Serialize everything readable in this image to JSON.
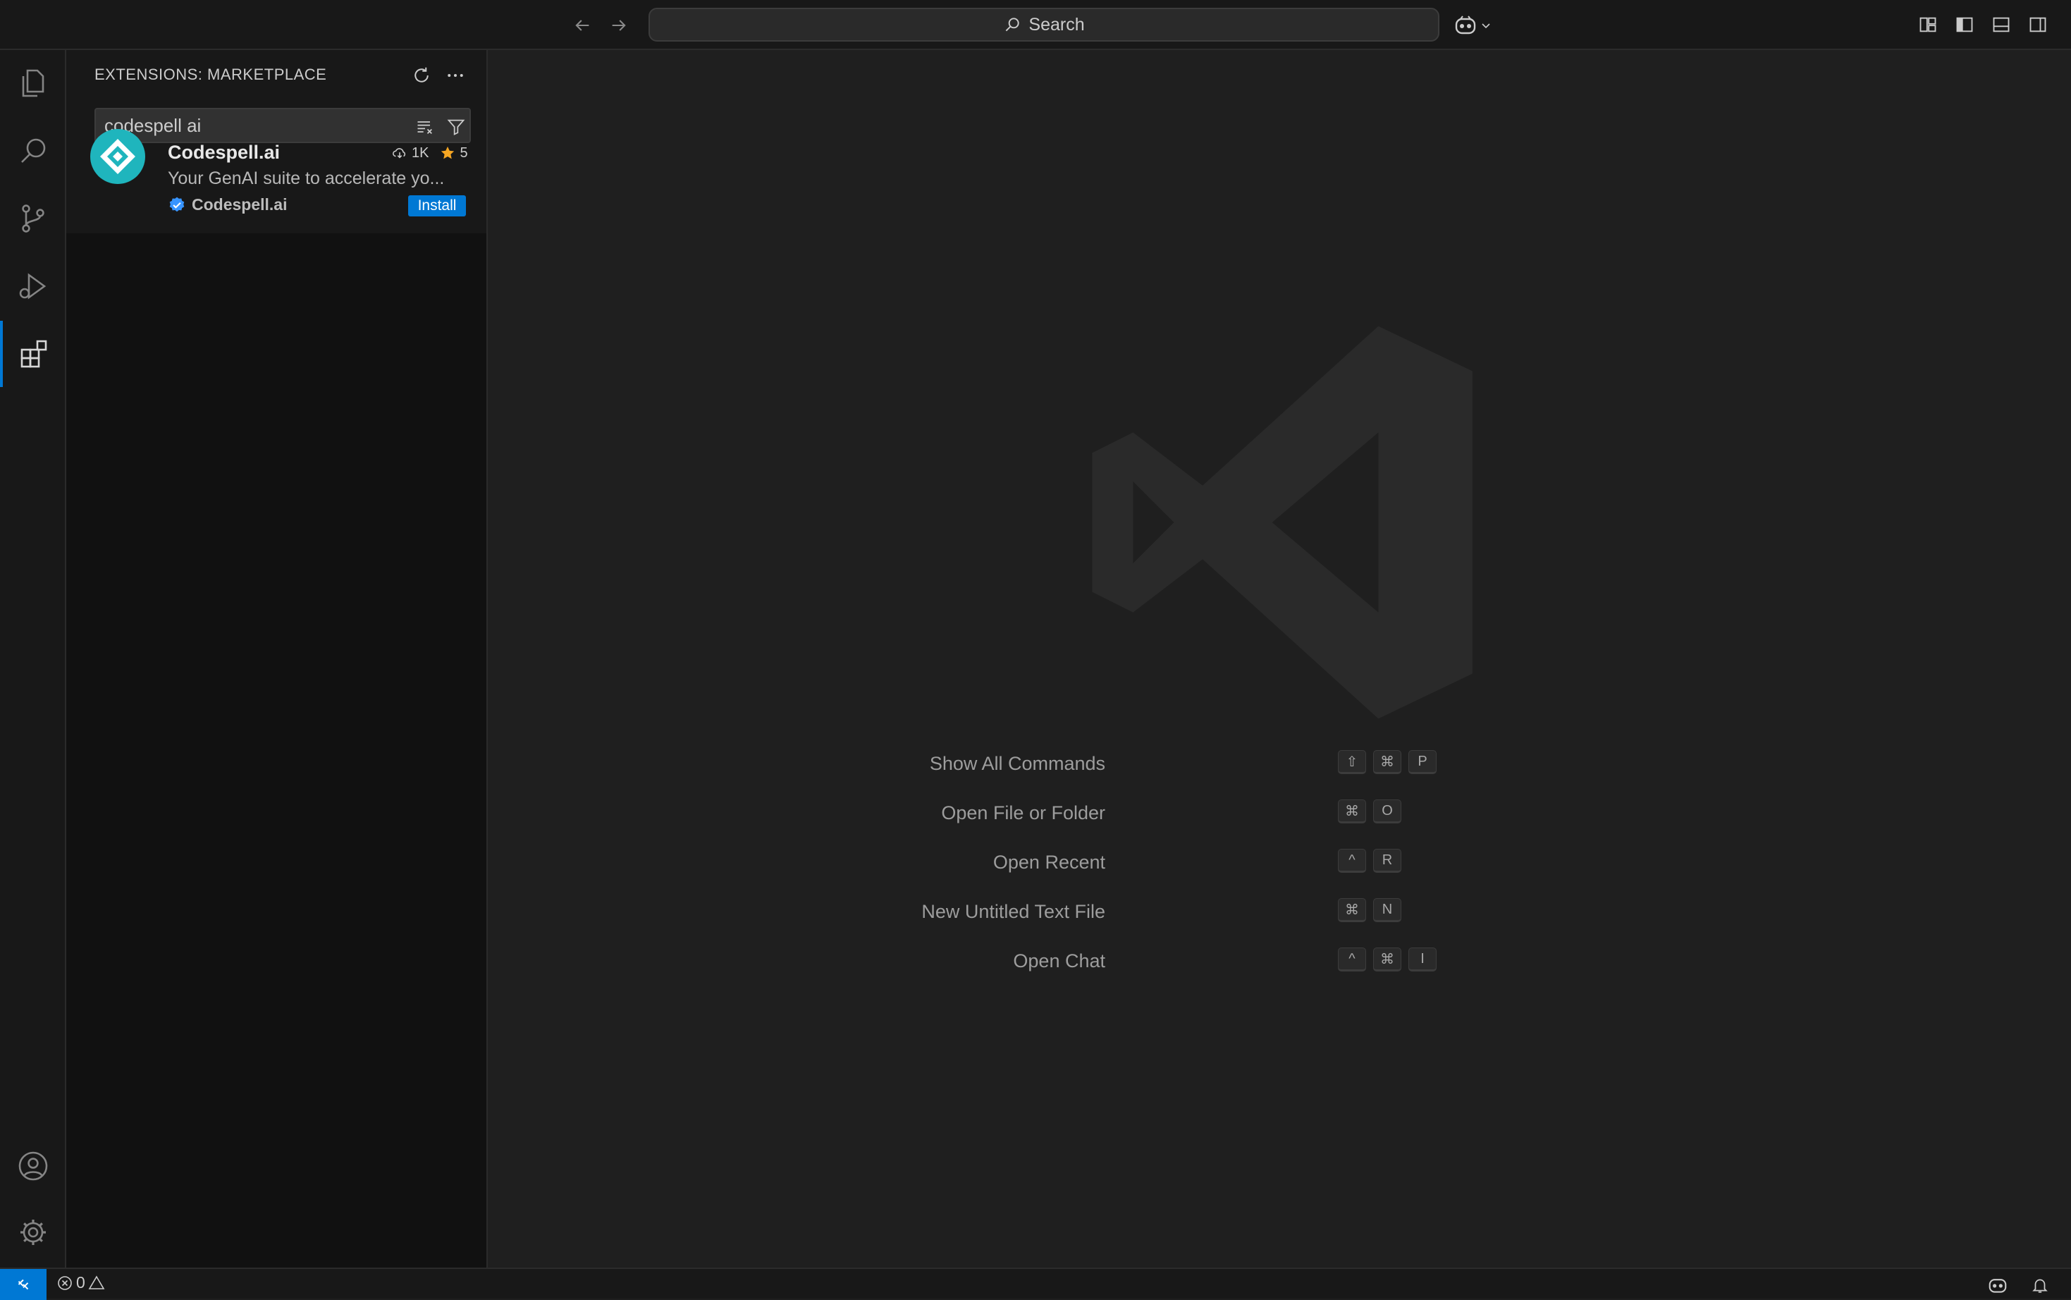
{
  "titlebar": {
    "search_label": "Search"
  },
  "sidebar": {
    "title": "EXTENSIONS: MARKETPLACE",
    "search_value": "codespell ai"
  },
  "extension": {
    "name": "Codespell.ai",
    "installs": "1K",
    "rating": "5",
    "description": "Your GenAI suite to accelerate yo...",
    "publisher": "Codespell.ai",
    "install_label": "Install"
  },
  "welcome": {
    "commands": [
      {
        "label": "Show All Commands",
        "keys": [
          "⇧",
          "⌘",
          "P"
        ]
      },
      {
        "label": "Open File or Folder",
        "keys": [
          "⌘",
          "O"
        ]
      },
      {
        "label": "Open Recent",
        "keys": [
          "^",
          "R"
        ]
      },
      {
        "label": "New Untitled Text File",
        "keys": [
          "⌘",
          "N"
        ]
      },
      {
        "label": "Open Chat",
        "keys": [
          "^",
          "⌘",
          "I"
        ]
      }
    ]
  },
  "statusbar": {
    "errors": "0",
    "warnings": ""
  },
  "colors": {
    "accent": "#0078d4",
    "background": "#1f1f1f",
    "sidebar": "#181818",
    "star": "#f5a623",
    "verified": "#3794ff"
  },
  "icons": {
    "activity": [
      "explorer-icon",
      "search-icon",
      "source-control-icon",
      "run-debug-icon",
      "extensions-icon",
      "accounts-icon",
      "manage-gear-icon"
    ]
  }
}
